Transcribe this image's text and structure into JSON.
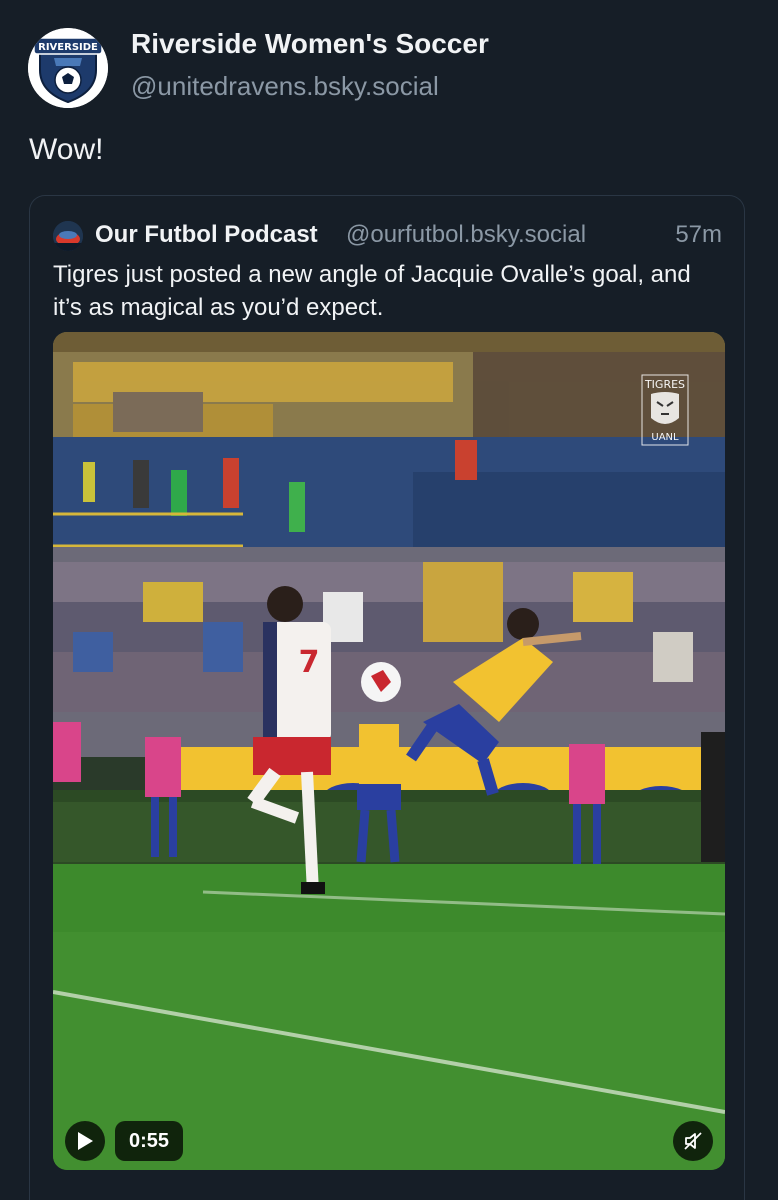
{
  "post": {
    "author_name": "Riverside Women's Soccer",
    "author_handle": "@unitedravens.bsky.social",
    "avatar_text": "RIVERSIDE",
    "text": "Wow!"
  },
  "quote": {
    "author_name": "Our Futbol Podcast",
    "author_handle": "@ourfutbol.bsky.social",
    "time_ago": "57m",
    "text": "Tigres just posted a new angle of Jacquie Ovalle’s goal, and it’s as magical as you’d expect."
  },
  "video": {
    "duration": "0:55",
    "watermark_top": "TIGRES",
    "watermark_bottom": "UANL",
    "player_number": "7",
    "play_icon": "play-icon",
    "mute_icon": "speaker-muted-icon"
  },
  "colors": {
    "background": "#161e27",
    "text_primary": "#f1f3f5",
    "text_secondary": "#8b98a5",
    "card_border": "#2a3644",
    "pitch_green": "#3d8a2c",
    "tigres_gold": "#f2c230"
  }
}
